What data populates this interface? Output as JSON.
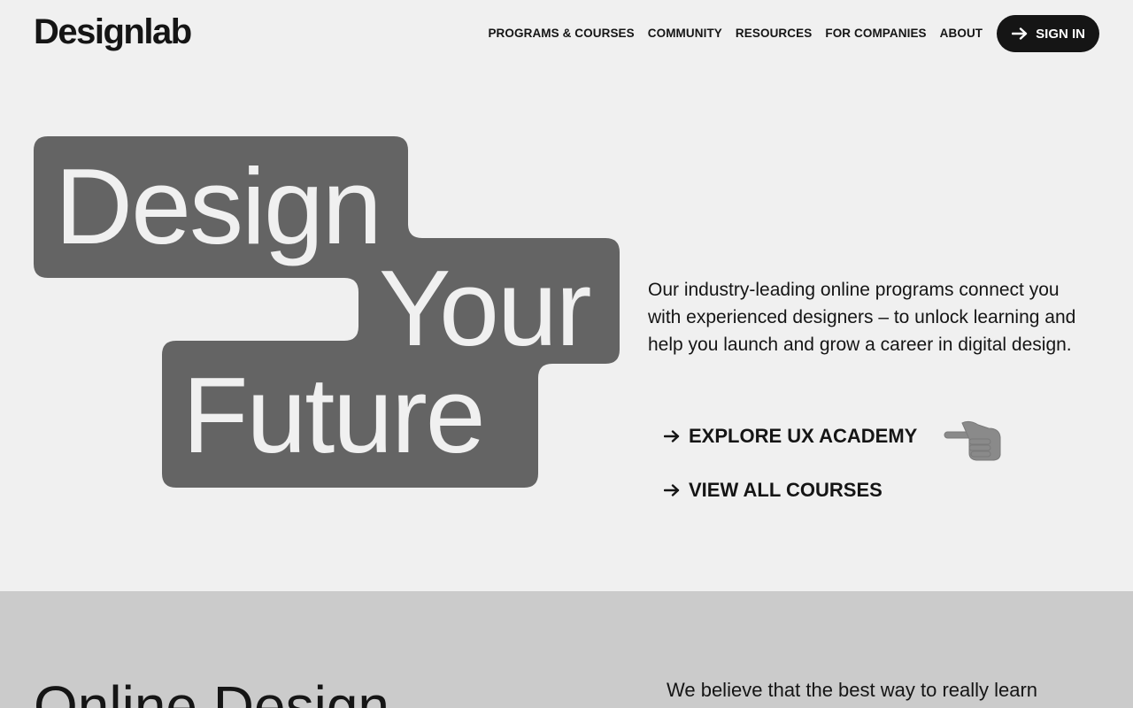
{
  "brand": {
    "name": "Designlab"
  },
  "nav": {
    "items": [
      {
        "label": "PROGRAMS & COURSES"
      },
      {
        "label": "COMMUNITY"
      },
      {
        "label": "RESOURCES"
      },
      {
        "label": "FOR COMPANIES"
      },
      {
        "label": "ABOUT"
      }
    ],
    "signin_label": "SIGN IN"
  },
  "hero": {
    "headline": [
      "Design",
      "Your",
      "Future"
    ],
    "description": "Our industry-leading online programs connect you with experienced designers – to unlock learning and help you launch and grow a career in digital design.",
    "cta_primary": "EXPLORE UX ACADEMY",
    "cta_secondary": "VIEW ALL COURSES",
    "accent_color": "#646464"
  },
  "section2": {
    "title": "Online Design",
    "text": "We believe that the best way to really learn"
  },
  "icons": [
    "arrow-right-icon",
    "pointing-hand-icon"
  ]
}
